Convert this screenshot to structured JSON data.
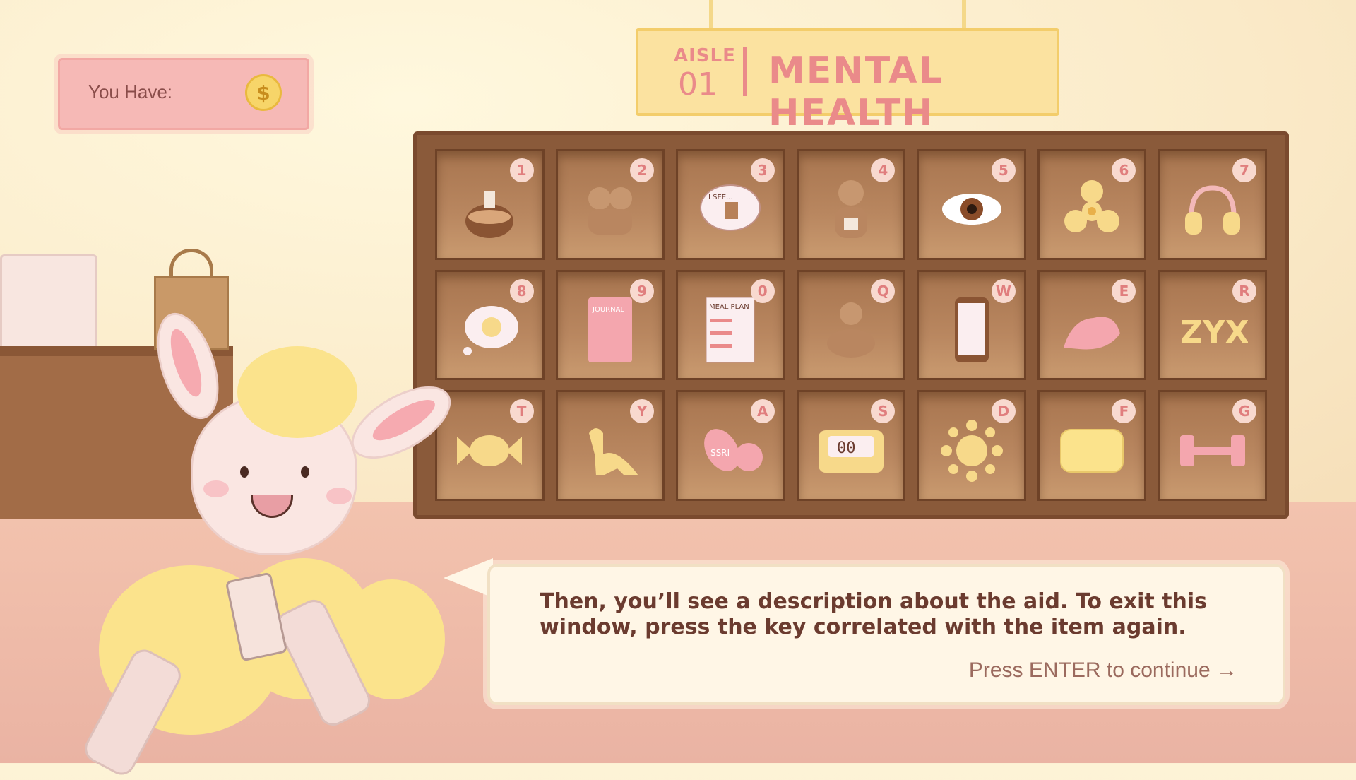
{
  "hud": {
    "coins_label": "You Have:",
    "coin_icon": "coin-dollar-icon",
    "coin_symbol": "$"
  },
  "aisle": {
    "word": "AISLE",
    "number": "01",
    "title": "MENTAL HEALTH"
  },
  "shelf": {
    "items": [
      {
        "key": "1",
        "icon": "aroma-diffuser-icon"
      },
      {
        "key": "2",
        "icon": "hugging-friends-icon"
      },
      {
        "key": "3",
        "icon": "therapy-speech-bubble-icon",
        "text": "I SEE..."
      },
      {
        "key": "4",
        "icon": "person-with-mug-icon"
      },
      {
        "key": "5",
        "icon": "eye-icon"
      },
      {
        "key": "6",
        "icon": "fidget-spinner-icon"
      },
      {
        "key": "7",
        "icon": "headphones-icon"
      },
      {
        "key": "8",
        "icon": "sad-thought-cloud-icon"
      },
      {
        "key": "9",
        "icon": "journal-icon",
        "text": "JOURNAL"
      },
      {
        "key": "0",
        "icon": "meal-plan-icon",
        "text": "MEAL PLAN"
      },
      {
        "key": "Q",
        "icon": "meditating-person-icon"
      },
      {
        "key": "W",
        "icon": "phone-icon"
      },
      {
        "key": "E",
        "icon": "flexed-arm-icon"
      },
      {
        "key": "R",
        "icon": "zyx-letters-icon",
        "text": "ZYX"
      },
      {
        "key": "T",
        "icon": "candy-icon"
      },
      {
        "key": "Y",
        "icon": "dinosaur-icon"
      },
      {
        "key": "A",
        "icon": "ssri-pills-icon",
        "text": "SSRI"
      },
      {
        "key": "S",
        "icon": "timer-clock-icon",
        "text": "00"
      },
      {
        "key": "D",
        "icon": "sun-icon"
      },
      {
        "key": "F",
        "icon": "pillow-icon"
      },
      {
        "key": "G",
        "icon": "dumbbell-icon"
      }
    ]
  },
  "dialog": {
    "text": "Then, you’ll see a description about the aid. To exit this window, press the key correlated with the item again.",
    "continue": "Press ENTER to continue →"
  }
}
